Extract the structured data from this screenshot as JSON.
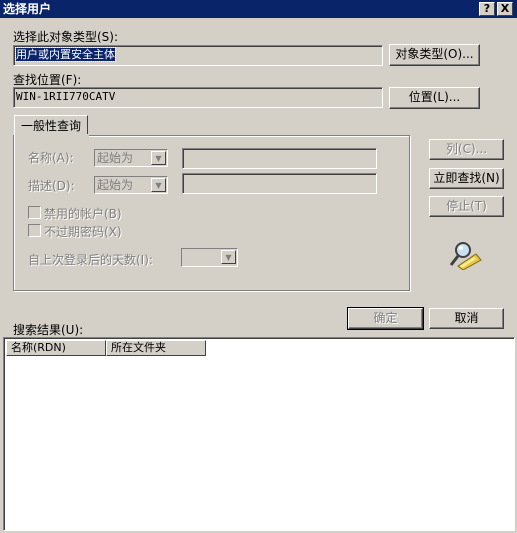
{
  "window": {
    "title": "选择用户",
    "help_glyph": "?",
    "close_glyph": "X"
  },
  "object_type": {
    "label": "选择此对象类型(S):",
    "value": "用户或内置安全主体",
    "button": "对象类型(O)..."
  },
  "location": {
    "label": "查找位置(F):",
    "value": "WIN-1RII770CATV",
    "button": "位置(L)..."
  },
  "tab": {
    "label": "一般性查询"
  },
  "query": {
    "name_label": "名称(A):",
    "name_mode": "起始为",
    "desc_label": "描述(D):",
    "desc_mode": "起始为",
    "disabled_accounts": "禁用的帐户(B)",
    "no_expire_pwd": "不过期密码(X)",
    "days_label": "自上次登录后的天数(I):"
  },
  "side_buttons": {
    "columns": "列(C)...",
    "find_now": "立即查找(N)",
    "stop": "停止(T)"
  },
  "dialog_buttons": {
    "ok": "确定",
    "cancel": "取消"
  },
  "results": {
    "label": "搜索结果(U):",
    "columns": [
      "名称(RDN)",
      "所在文件夹"
    ]
  }
}
